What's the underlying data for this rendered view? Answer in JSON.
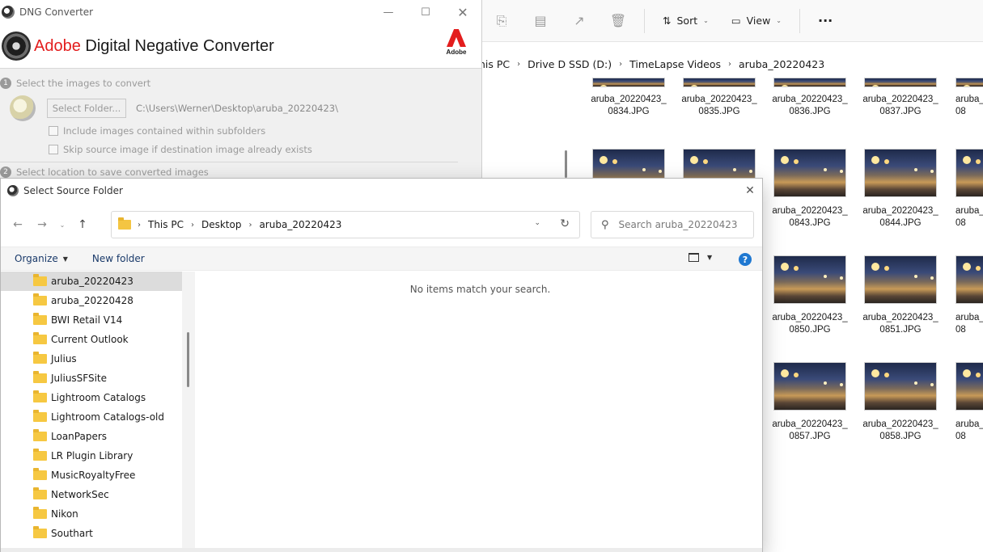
{
  "explorer": {
    "toolbar": {
      "sort_label": "Sort",
      "view_label": "View",
      "more_label": "···"
    },
    "breadcrumb": [
      "nis PC",
      "Drive D SSD (D:)",
      "TimeLapse Videos",
      "aruba_20220423"
    ],
    "thumbnails": [
      [
        "aruba_20220423_",
        "0834.JPG"
      ],
      [
        "aruba_20220423_",
        "0835.JPG"
      ],
      [
        "aruba_20220423_",
        "0836.JPG"
      ],
      [
        "aruba_20220423_",
        "0837.JPG"
      ],
      [
        "aruba_",
        "08"
      ],
      [
        "aruba_20220423_",
        "0843.JPG"
      ],
      [
        "aruba_20220423_",
        "0844.JPG"
      ],
      [
        "aruba_",
        "08"
      ],
      [
        "aruba_20220423_",
        "0850.JPG"
      ],
      [
        "aruba_20220423_",
        "0851.JPG"
      ],
      [
        "aruba_",
        "08"
      ],
      [
        "aruba_20220423_",
        "0857.JPG"
      ],
      [
        "aruba_20220423_",
        "0858.JPG"
      ],
      [
        "aruba_",
        "08"
      ]
    ]
  },
  "dng": {
    "window_title": "DNG Converter",
    "brand_adobe": "Adobe",
    "brand_product": "Digital Negative Converter",
    "adobe_mark_text": "Adobe",
    "step1_number": "1",
    "step1_label": "Select the images to convert",
    "select_folder_label": "Select Folder...",
    "source_path": "C:\\Users\\Werner\\Desktop\\aruba_20220423\\",
    "include_subfolders_label": "Include images contained within subfolders",
    "skip_existing_label": "Skip source image if destination image already exists",
    "step2_number": "2",
    "step2_label": "Select location to save converted images"
  },
  "dialog": {
    "title": "Select Source Folder",
    "breadcrumb": [
      "This PC",
      "Desktop",
      "aruba_20220423"
    ],
    "search_placeholder": "Search aruba_20220423",
    "organize_label": "Organize",
    "new_folder_label": "New folder",
    "help_label": "?",
    "empty_message": "No items match your search.",
    "folders": [
      {
        "name": "aruba_20220423",
        "selected": true
      },
      {
        "name": "aruba_20220428",
        "selected": false
      },
      {
        "name": "BWI Retail V14",
        "selected": false
      },
      {
        "name": "Current Outlook",
        "selected": false
      },
      {
        "name": "Julius",
        "selected": false
      },
      {
        "name": "JuliusSFSite",
        "selected": false
      },
      {
        "name": "Lightroom Catalogs",
        "selected": false
      },
      {
        "name": "Lightroom Catalogs-old",
        "selected": false
      },
      {
        "name": "LoanPapers",
        "selected": false
      },
      {
        "name": "LR Plugin Library",
        "selected": false
      },
      {
        "name": "MusicRoyaltyFree",
        "selected": false
      },
      {
        "name": "NetworkSec",
        "selected": false
      },
      {
        "name": "Nikon",
        "selected": false
      },
      {
        "name": "Southart",
        "selected": false
      }
    ]
  },
  "colors": {
    "adobe_red": "#e31d1d",
    "folder_yellow": "#f6c842",
    "help_blue": "#1f78d1",
    "selection_gray": "#dcdcdc"
  }
}
